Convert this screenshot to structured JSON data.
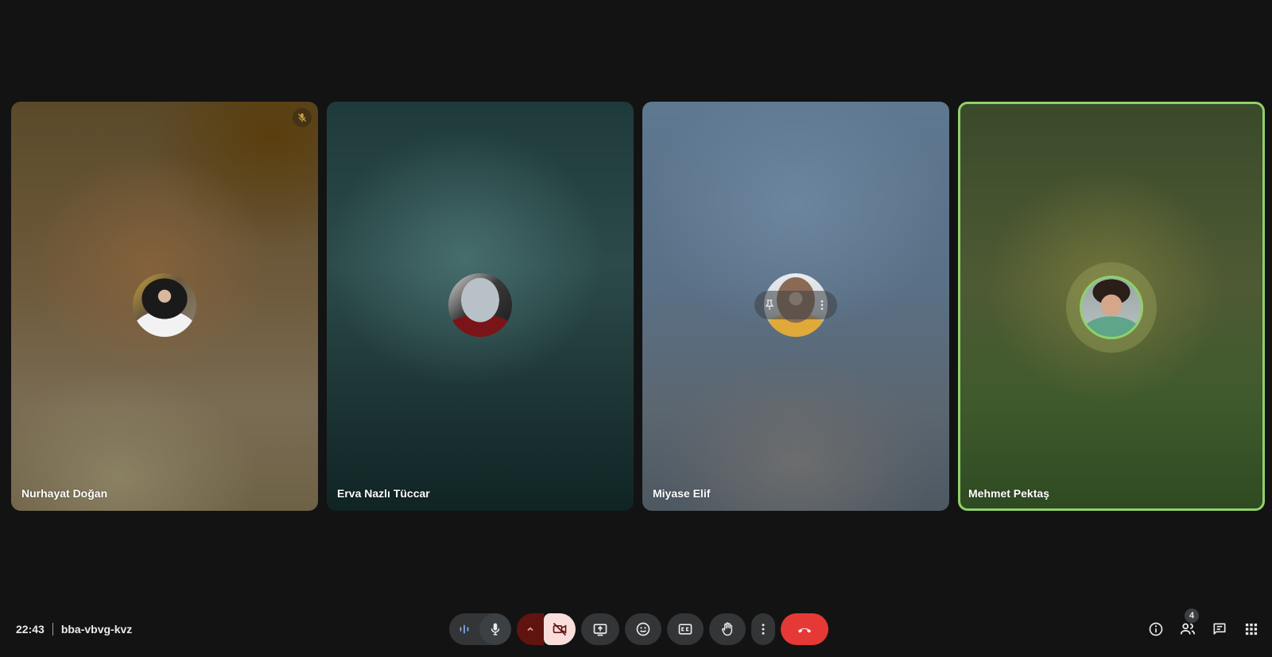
{
  "meeting": {
    "time": "22:43",
    "code": "bba-vbvg-kvz"
  },
  "participants": [
    {
      "name": "Nurhayat Doğan",
      "muted": true
    },
    {
      "name": "Erva Nazlı Tüccar",
      "muted": false
    },
    {
      "name": "Miyase Elif",
      "muted": false,
      "hovered": true
    },
    {
      "name": "Mehmet Pektaş",
      "muted": false,
      "speaking": true
    }
  ],
  "controls": {
    "items": [
      "audio-levels",
      "microphone",
      "camera-options",
      "camera-off",
      "present-screen",
      "reactions",
      "captions",
      "raise-hand",
      "more-options",
      "leave-call"
    ],
    "camera_state": "off",
    "end_call_color": "#e53935"
  },
  "right_panel": {
    "people_count": "4",
    "items": [
      "meeting-details",
      "people",
      "chat",
      "activities"
    ]
  },
  "colors": {
    "background": "#131313",
    "speaking_border": "#8fd16a",
    "camera_off_bg": "#f9dedc",
    "camera_menu_bg": "#601410",
    "end_call": "#e53935"
  }
}
